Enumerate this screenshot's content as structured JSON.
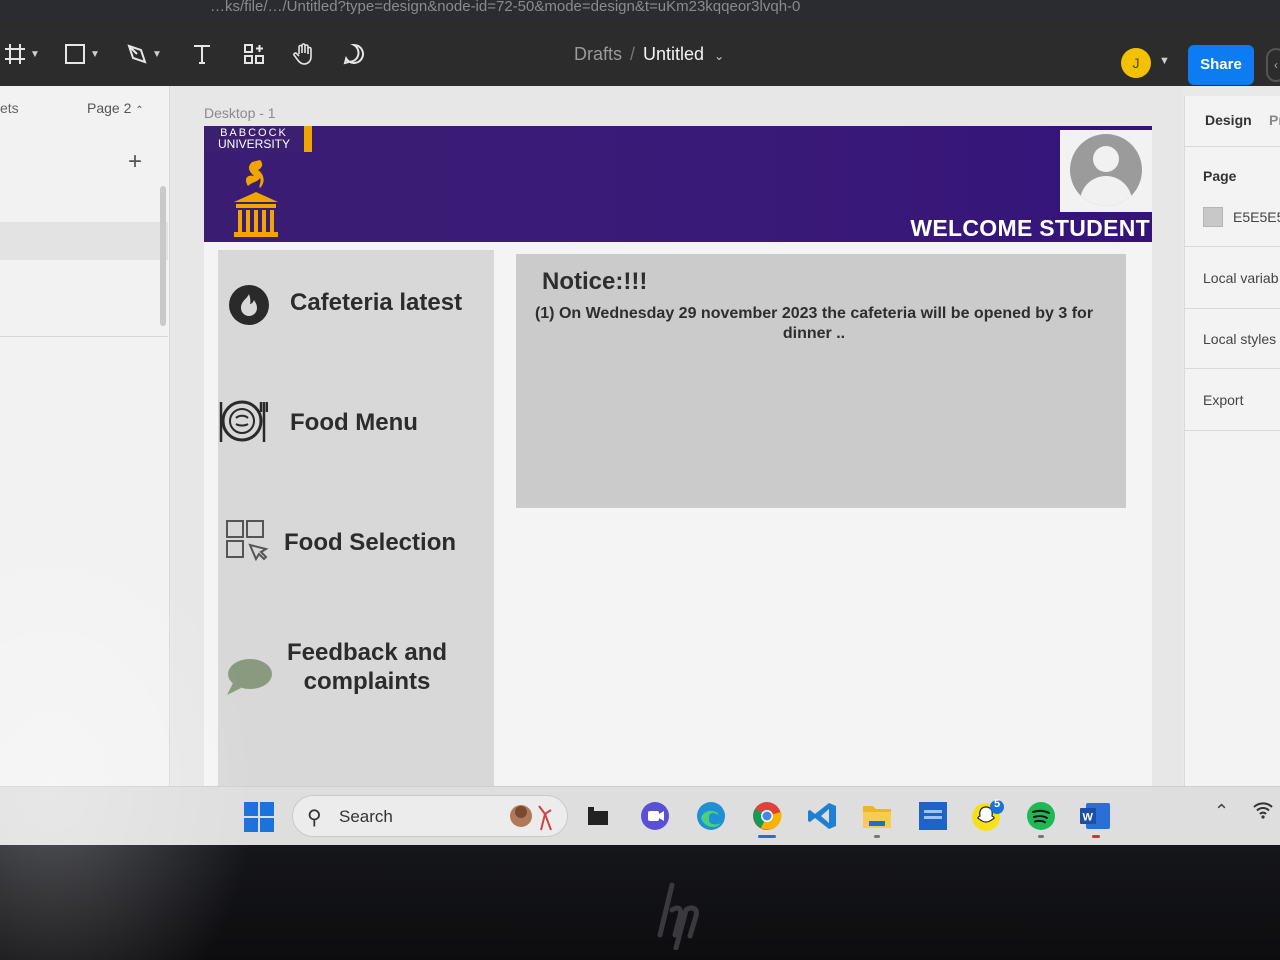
{
  "browser": {
    "url_fragment": "…ks/file/…/Untitled?type=design&node-id=72-50&mode=design&t=uKm23kqqeor3lvqh-0"
  },
  "toolbar": {
    "breadcrumb_parent": "Drafts",
    "breadcrumb_separator": "/",
    "file_name": "Untitled",
    "user_initial": "J",
    "share_label": "Share"
  },
  "left_panel": {
    "assets_tab": "ets",
    "page_selector": "Page 2",
    "add_label": "+"
  },
  "canvas": {
    "frame_label": "Desktop - 1"
  },
  "design": {
    "logo_line1": "BABCOCK",
    "logo_line2": "UNIVERSITY",
    "welcome": "WELCOME STUDENT",
    "menu": [
      {
        "label": "Cafeteria latest"
      },
      {
        "label": "Food Menu"
      },
      {
        "label": "Food Selection"
      },
      {
        "label_line1": "Feedback and",
        "label_line2": "complaints"
      }
    ],
    "notice": {
      "title": "Notice:!!!",
      "body": "(1) On Wednesday 29 november 2023 the cafeteria will be opened by 3 for dinner .."
    }
  },
  "right_panel": {
    "tab_design": "Design",
    "tab_prototype": "Pr",
    "page_label": "Page",
    "page_color_hex": "E5E5E5",
    "local_variables": "Local variab",
    "local_styles": "Local styles",
    "export": "Export"
  },
  "taskbar": {
    "search_placeholder": "Search",
    "notification_count": "5"
  },
  "colors": {
    "banner": "#3a1d73",
    "accent_gold": "#f0a500",
    "share_blue": "#0d7cf2",
    "figma_toolbar": "#2c2c2c"
  }
}
